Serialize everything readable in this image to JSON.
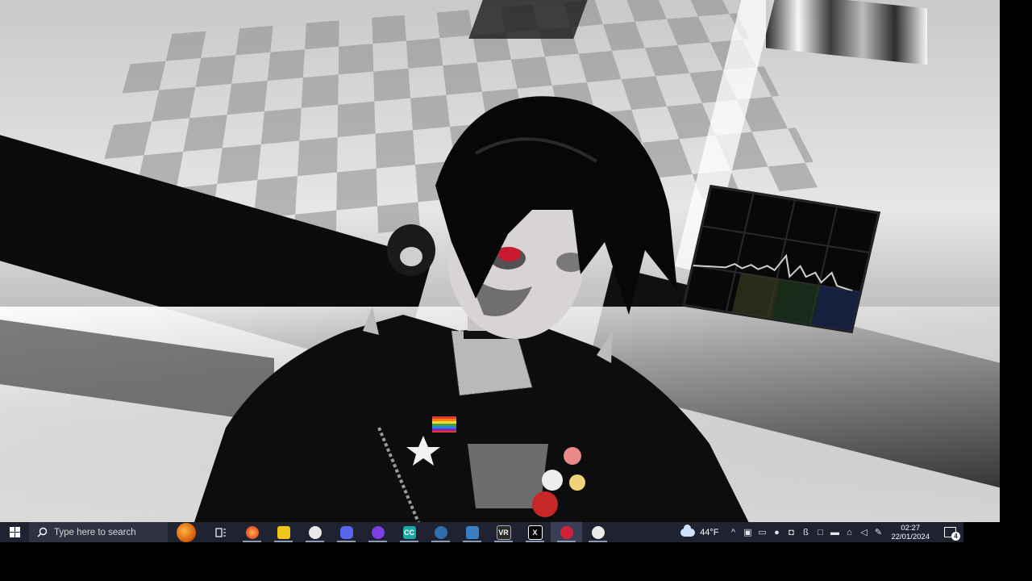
{
  "taskbar": {
    "search_placeholder": "Type here to search",
    "apps": [
      {
        "name": "task-view",
        "label": "",
        "color": "#1f2230"
      },
      {
        "name": "firefox",
        "label": "",
        "color": "#ff7139"
      },
      {
        "name": "file-explorer",
        "label": "",
        "color": "#f0c419"
      },
      {
        "name": "penguin-app",
        "label": "",
        "color": "#e8e8e8"
      },
      {
        "name": "discord",
        "label": "",
        "color": "#5865f2"
      },
      {
        "name": "mask-app",
        "label": "",
        "color": "#7b3fe4"
      },
      {
        "name": "cc-app",
        "label": "CC",
        "color": "#1aa7a7"
      },
      {
        "name": "steam-like-app",
        "label": "",
        "color": "#2f6fb0"
      },
      {
        "name": "vtuber-app",
        "label": "",
        "color": "#3a7fc2"
      },
      {
        "name": "vr-app",
        "label": "VR",
        "color": "#2b2b2b"
      },
      {
        "name": "x-app",
        "label": "X",
        "color": "#000000"
      },
      {
        "name": "record-app",
        "label": "",
        "color": "#d0213a"
      },
      {
        "name": "panda-app",
        "label": "",
        "color": "#eaeaea"
      }
    ],
    "weather": {
      "temp": "44°F"
    },
    "clock": {
      "time": "02:27",
      "date": "22/01/2024"
    },
    "notifications": {
      "count": "4"
    }
  },
  "colors": {
    "taskbar_bg": "#1f2230",
    "search_bg": "#2e3242"
  }
}
